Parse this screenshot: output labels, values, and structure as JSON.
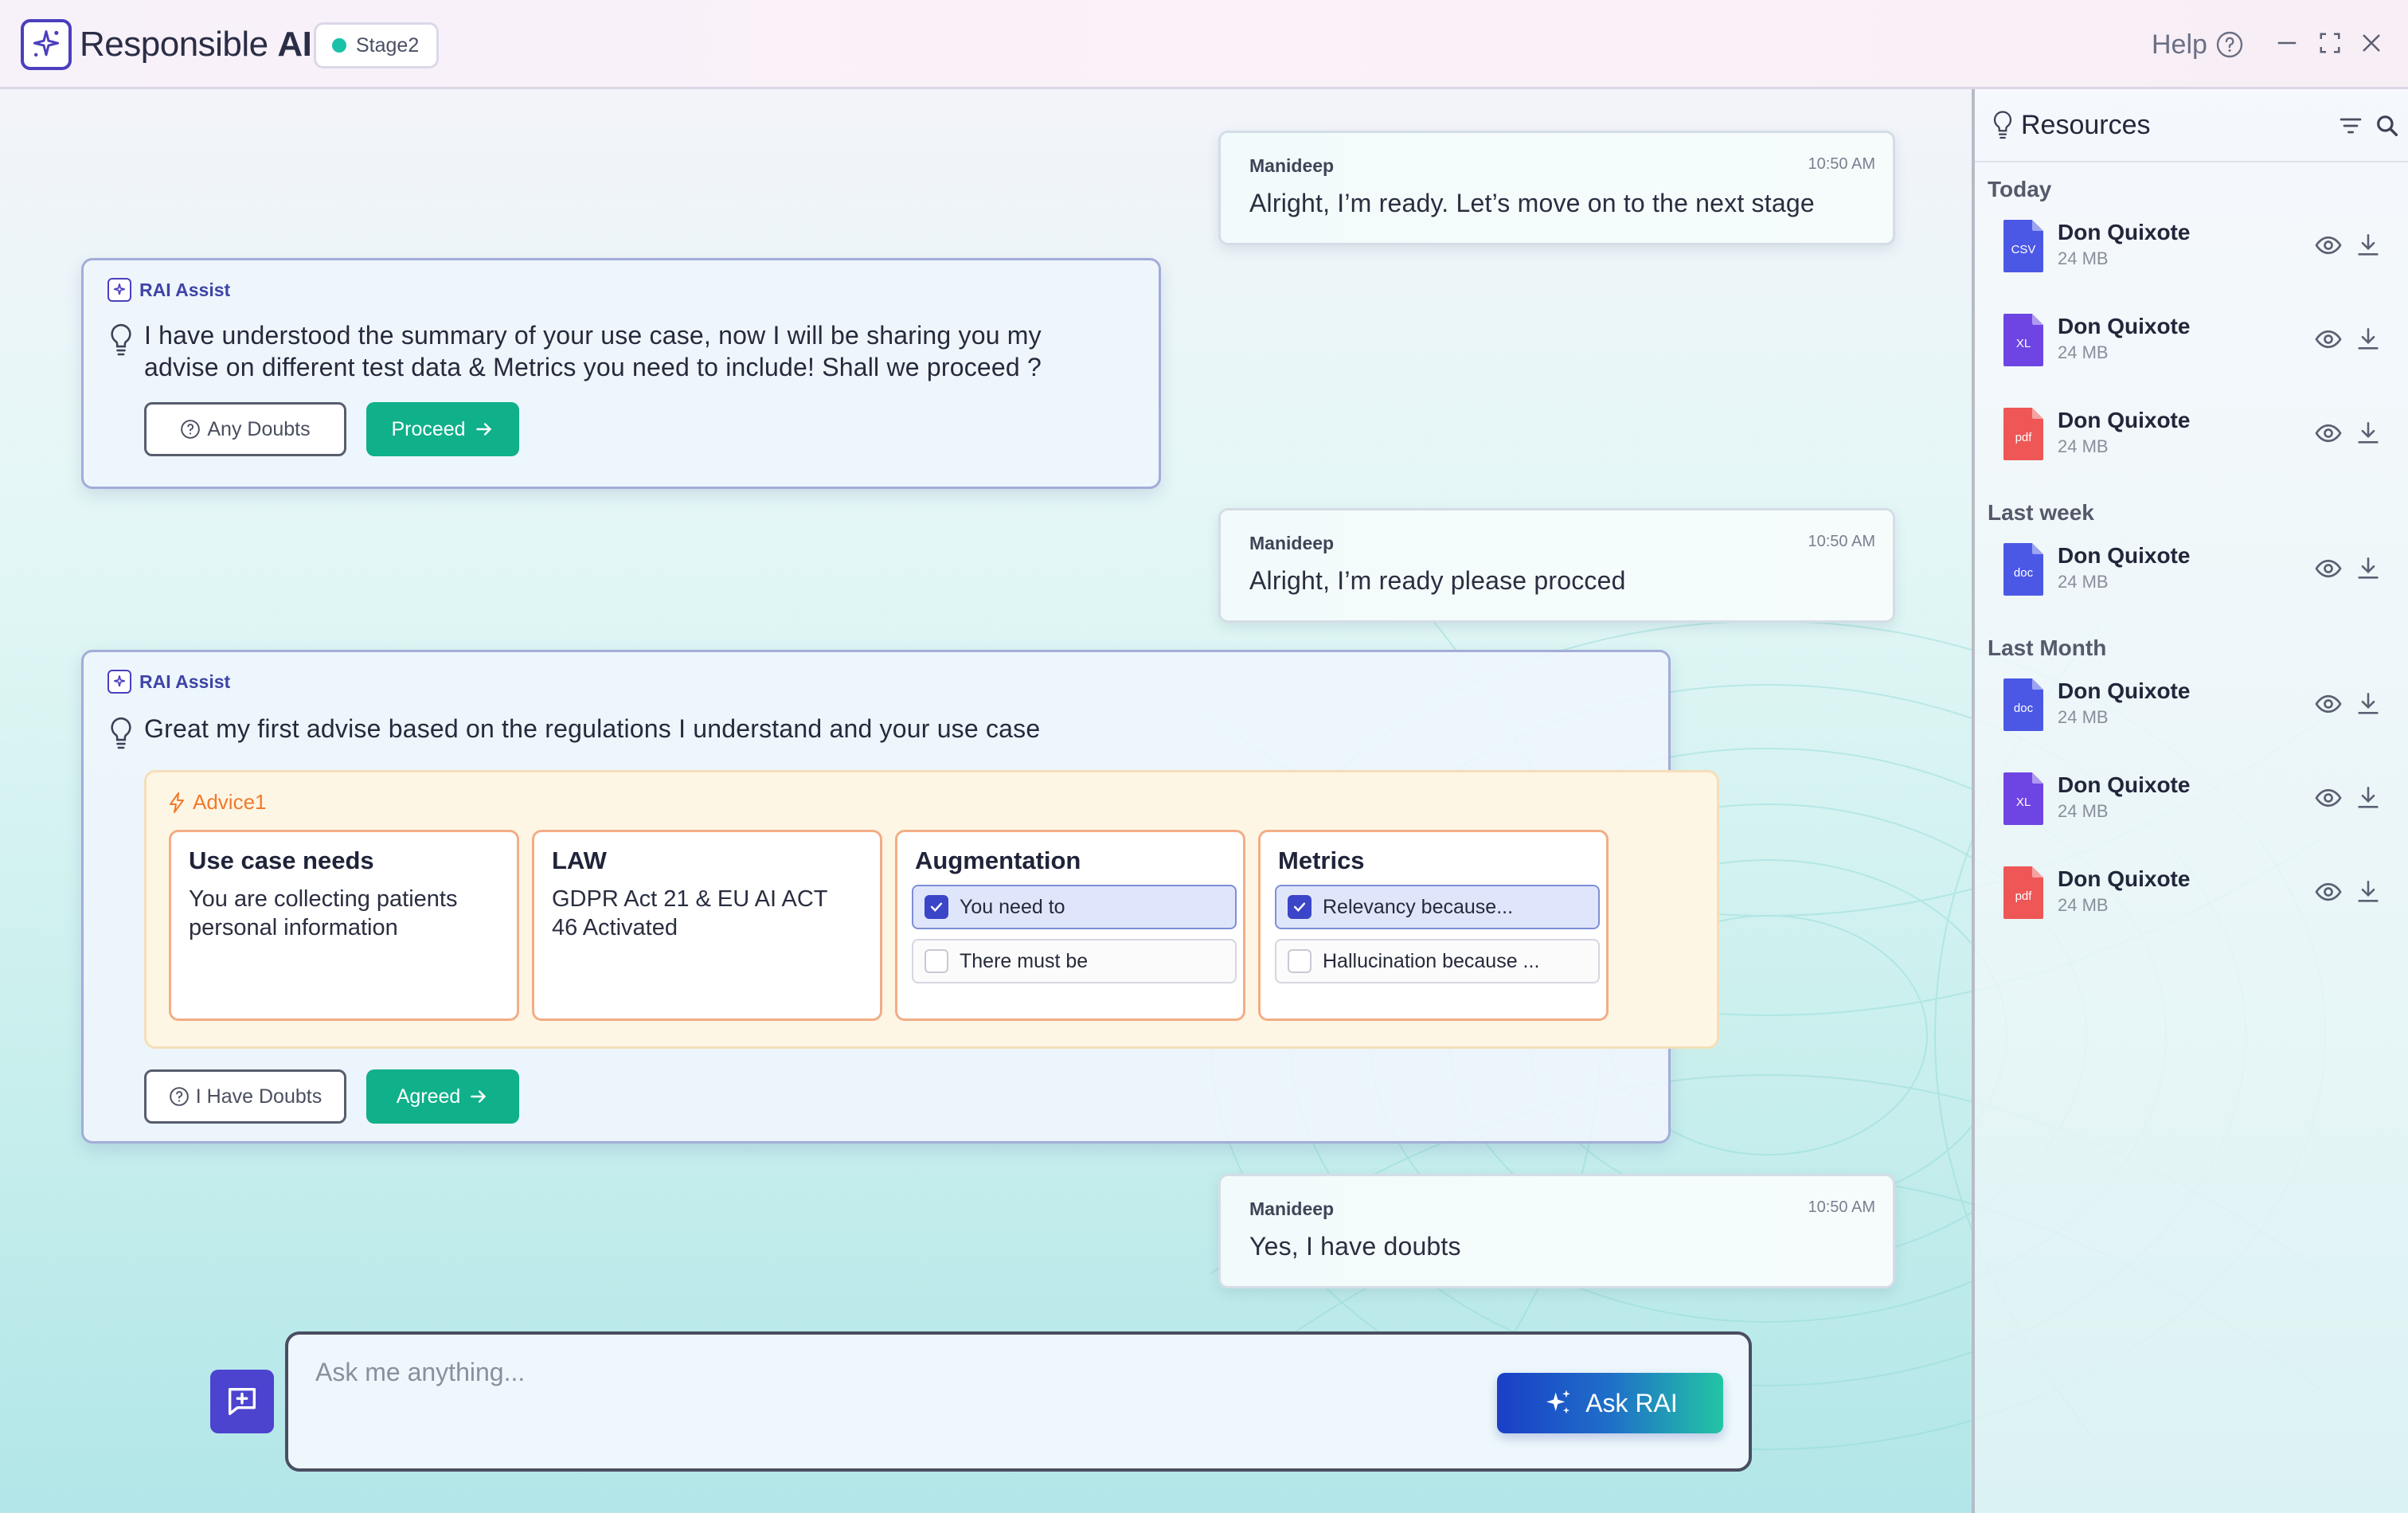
{
  "header": {
    "app_title_light": "Responsible",
    "app_title_bold": "AI",
    "stage_label": "Stage2",
    "help_label": "Help"
  },
  "messages": {
    "user1": {
      "sender": "Manideep",
      "time": "10:50 AM",
      "text": "Alright, I’m ready. Let’s move on to the next stage"
    },
    "rai1": {
      "sender": "RAI Assist",
      "text_line1": "I have understood the summary of your use case, now I will be sharing you my",
      "text_line2": "advise on different test data & Metrics you need to include! Shall we proceed ?",
      "doubt_btn": "Any Doubts",
      "proceed_btn": "Proceed"
    },
    "user2": {
      "sender": "Manideep",
      "time": "10:50 AM",
      "text": "Alright, I’m ready please procced"
    },
    "rai2": {
      "sender": "RAI Assist",
      "text": "Great my first advise based on the regulations I understand and your use case",
      "advice_label": "Advice1",
      "columns": {
        "use_case": {
          "title": "Use case needs",
          "line1": "You are collecting patients",
          "line2": "personal information"
        },
        "law": {
          "title": "LAW",
          "line1": "GDPR Act 21 & EU AI ACT",
          "line2": "46 Activated"
        },
        "augmentation": {
          "title": "Augmentation",
          "option1": "You need to",
          "option1_checked": true,
          "option2": "There must be",
          "option2_checked": false
        },
        "metrics": {
          "title": "Metrics",
          "option1": "Relevancy because...",
          "option1_checked": true,
          "option2": "Hallucination because ...",
          "option2_checked": false
        }
      },
      "doubt_btn": "I Have Doubts",
      "agree_btn": "Agreed"
    },
    "user3": {
      "sender": "Manideep",
      "time": "10:50 AM",
      "text": "Yes, I have doubts"
    }
  },
  "composer": {
    "placeholder": "Ask me anything...",
    "ask_btn": "Ask RAI"
  },
  "resources": {
    "title": "Resources",
    "groups": [
      {
        "label": "Today",
        "items": [
          {
            "name": "Don Quixote",
            "size": "24 MB",
            "type": "CSV"
          },
          {
            "name": "Don Quixote",
            "size": "24 MB",
            "type": "XL"
          },
          {
            "name": "Don Quixote",
            "size": "24 MB",
            "type": "pdf"
          }
        ]
      },
      {
        "label": "Last week",
        "items": [
          {
            "name": "Don Quixote",
            "size": "24 MB",
            "type": "doc"
          }
        ]
      },
      {
        "label": "Last Month",
        "items": [
          {
            "name": "Don Quixote",
            "size": "24 MB",
            "type": "doc"
          },
          {
            "name": "Don Quixote",
            "size": "24 MB",
            "type": "XL"
          },
          {
            "name": "Don Quixote",
            "size": "24 MB",
            "type": "pdf"
          }
        ]
      }
    ]
  },
  "colors": {
    "brand": "#4b3fbe",
    "accent_green": "#0fb08a",
    "advice_orange": "#f07a2c",
    "file_blue": "#4b58e6",
    "file_purple": "#6e45e2",
    "file_red": "#ef5656"
  }
}
